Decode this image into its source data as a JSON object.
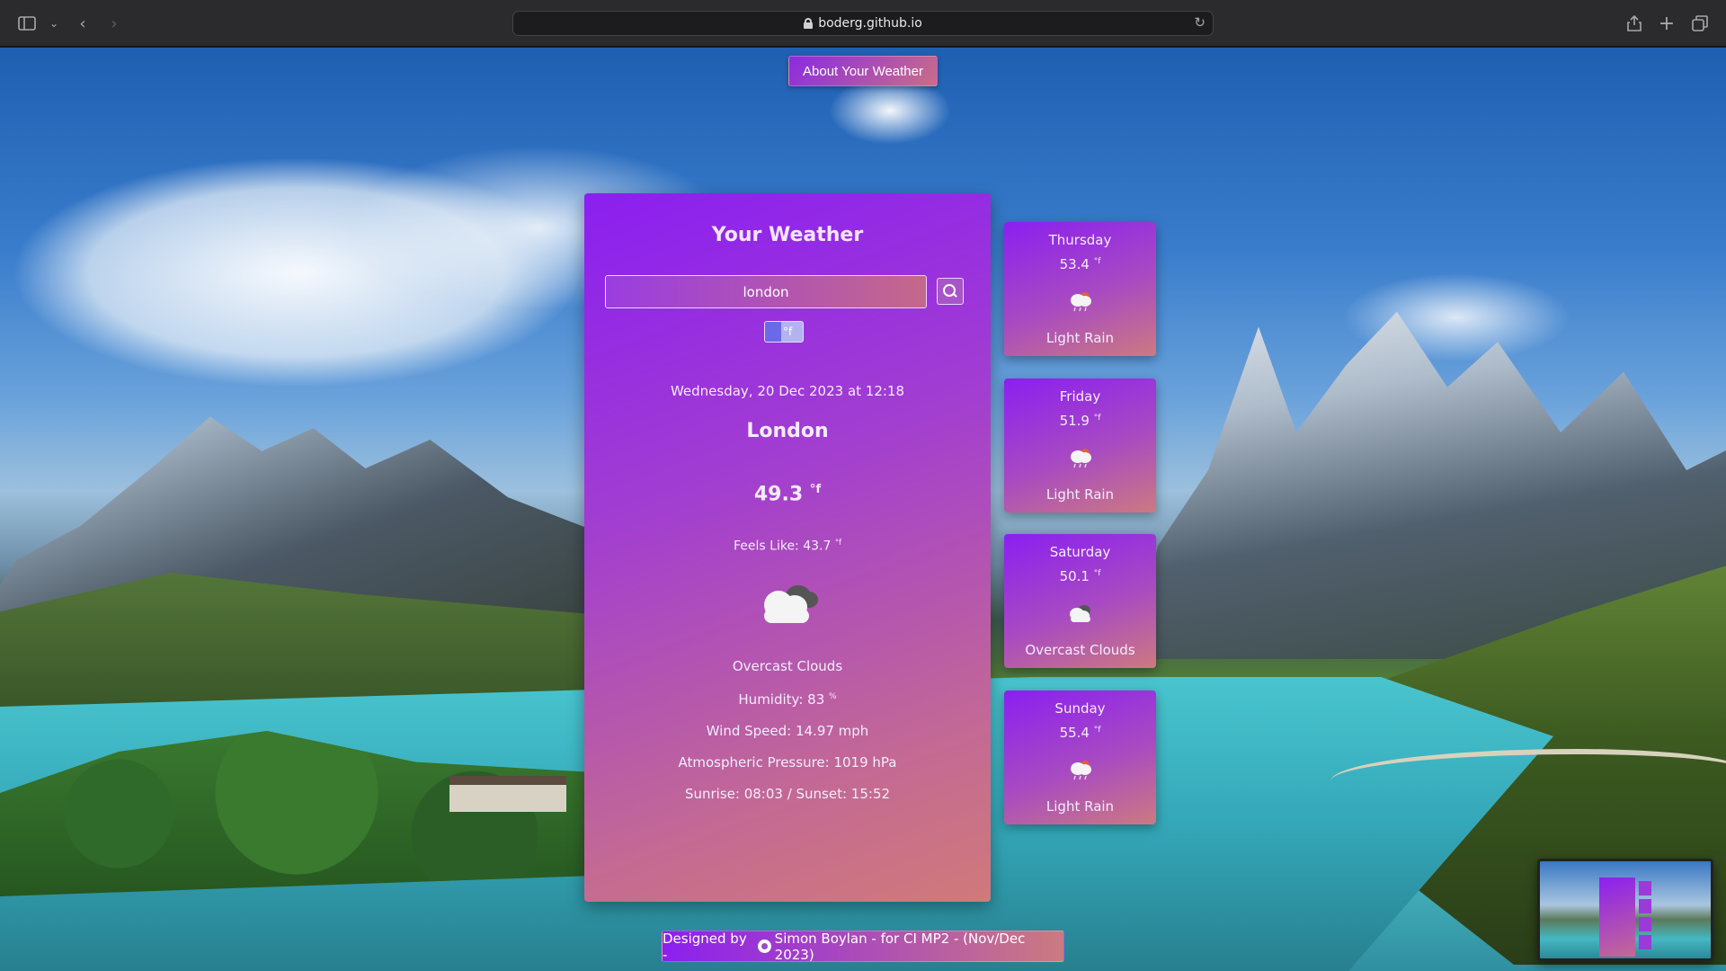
{
  "browser": {
    "url": "boderg.github.io"
  },
  "app": {
    "about_button": "About Your Weather",
    "title": "Your Weather",
    "search_value": "london",
    "unit_toggle_label": "°f",
    "date": "Wednesday, 20 Dec 2023 at 12:18",
    "city": "London",
    "temperature": "49.3",
    "temperature_unit": "°f",
    "feels_like": "Feels Like: 43.7",
    "feels_like_unit": "°f",
    "description": "Overcast Clouds",
    "humidity": "Humidity: 83",
    "humidity_unit": "%",
    "wind_speed": "Wind Speed: 14.97 mph",
    "pressure": "Atmospheric Pressure: 1019 hPa",
    "sun": "Sunrise: 08:03 / Sunset: 15:52",
    "weather_icon": "overcast-clouds-icon"
  },
  "forecast": [
    {
      "day": "Thursday",
      "temp": "53.4",
      "unit": "°f",
      "desc": "Light Rain",
      "icon": "light-rain-icon"
    },
    {
      "day": "Friday",
      "temp": "51.9",
      "unit": "°f",
      "desc": "Light Rain",
      "icon": "light-rain-icon"
    },
    {
      "day": "Saturday",
      "temp": "50.1",
      "unit": "°f",
      "desc": "Overcast Clouds",
      "icon": "overcast-clouds-icon"
    },
    {
      "day": "Sunday",
      "temp": "55.4",
      "unit": "°f",
      "desc": "Light Rain",
      "icon": "light-rain-icon"
    }
  ],
  "footer": {
    "prefix": "Designed by -",
    "credit": "Simon Boylan - for CI MP2 - (Nov/Dec 2023)"
  },
  "colors": {
    "card_gradient_start": "#8b1ff0",
    "card_gradient_end": "#cc7a80",
    "text": "#f4ecff"
  }
}
